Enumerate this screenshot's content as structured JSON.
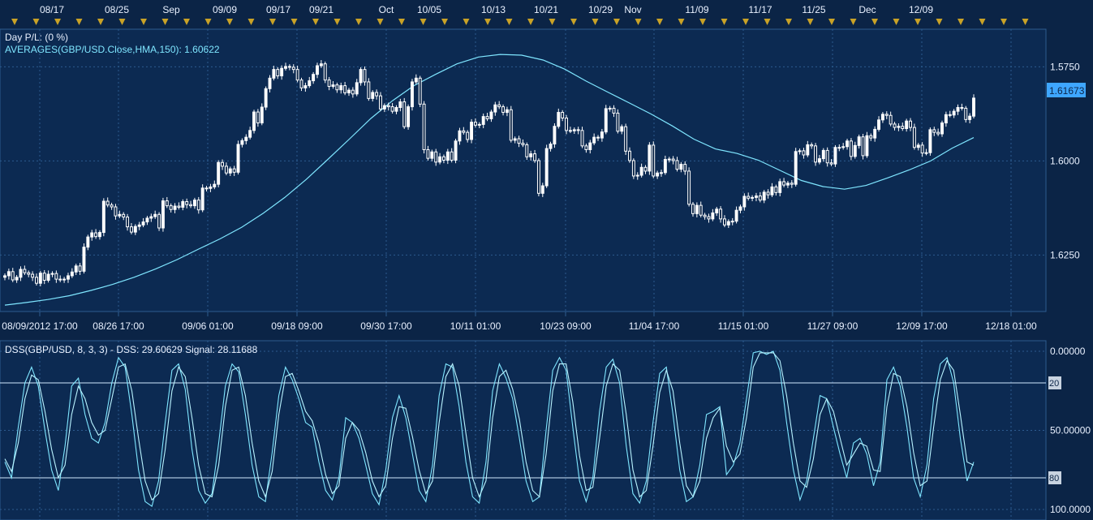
{
  "colors": {
    "background": "#0b2446",
    "panel": "#0c2a52",
    "grid": "#2d5b8f",
    "text": "#e9f1ff",
    "cyan": "#7fe6ff",
    "white": "#ffffff",
    "marker": "#c9a227",
    "price_label_bg": "#3ea6ff"
  },
  "top_axis": {
    "labels": [
      "08/17",
      "08/25",
      "Sep",
      "09/09",
      "09/17",
      "09/21",
      "Oct",
      "10/05",
      "10/13",
      "10/21",
      "10/29",
      "Nov",
      "11/09",
      "11/17",
      "11/25",
      "Dec",
      "12/09"
    ]
  },
  "price_panel": {
    "legend_line1": "Day P/L: (0 %)",
    "legend_line2": "AVERAGES(GBP/USD.Close,HMA,150): 1.60622",
    "y_ticks": [
      "1.6250",
      "1.6000",
      "1.5750"
    ],
    "last_price_label": "1.61673"
  },
  "bottom_axis": {
    "labels": [
      "08/09/2012 17:00",
      "08/26 17:00",
      "09/06 01:00",
      "09/18 09:00",
      "09/30 17:00",
      "10/11 01:00",
      "10/23 09:00",
      "11/04 17:00",
      "11/15 01:00",
      "11/27 09:00",
      "12/09 17:00",
      "12/18 01:00"
    ]
  },
  "dss_panel": {
    "legend": "DSS(GBP/USD, 8, 3, 3) -  DSS: 29.60629  Signal: 28.11688",
    "y_ticks": [
      "100.0000",
      "50.00000",
      "0.00000"
    ],
    "level_labels": [
      "80",
      "20"
    ]
  },
  "chart_data": [
    {
      "type": "candlestick",
      "symbol": "GBP/USD",
      "ylim": [
        1.56,
        1.635
      ],
      "y_ticks": [
        1.575,
        1.6,
        1.625
      ],
      "grid": true,
      "x_index_range": [
        0,
        240
      ],
      "closes": [
        1.5695,
        1.5706,
        1.5684,
        1.5691,
        1.5712,
        1.5703,
        1.5699,
        1.5691,
        1.5675,
        1.5702,
        1.5683,
        1.5699,
        1.5701,
        1.5686,
        1.5684,
        1.5686,
        1.5695,
        1.5705,
        1.5721,
        1.5707,
        1.5771,
        1.5798,
        1.5809,
        1.5799,
        1.581,
        1.5893,
        1.5883,
        1.5878,
        1.5854,
        1.5858,
        1.5851,
        1.5825,
        1.5811,
        1.5826,
        1.583,
        1.5838,
        1.5848,
        1.5852,
        1.5858,
        1.5822,
        1.5894,
        1.5881,
        1.5871,
        1.588,
        1.5877,
        1.5892,
        1.5884,
        1.5881,
        1.5896,
        1.587,
        1.5928,
        1.5927,
        1.5931,
        1.5938,
        1.5996,
        1.5986,
        1.5968,
        1.5979,
        1.597,
        1.6044,
        1.6054,
        1.6063,
        1.6081,
        1.613,
        1.6101,
        1.6143,
        1.6192,
        1.622,
        1.6243,
        1.6226,
        1.6246,
        1.6251,
        1.6249,
        1.6243,
        1.6215,
        1.6194,
        1.62,
        1.6213,
        1.623,
        1.6253,
        1.6258,
        1.6215,
        1.6198,
        1.6202,
        1.6189,
        1.62,
        1.6181,
        1.6188,
        1.6178,
        1.6208,
        1.6243,
        1.621,
        1.6166,
        1.6182,
        1.6173,
        1.6138,
        1.6147,
        1.6144,
        1.6132,
        1.6142,
        1.6157,
        1.6091,
        1.6144,
        1.621,
        1.622,
        1.6151,
        1.603,
        1.6007,
        1.6024,
        1.5997,
        1.6011,
        1.6002,
        1.6024,
        1.6002,
        1.6053,
        1.608,
        1.6076,
        1.6057,
        1.6103,
        1.6095,
        1.6097,
        1.6118,
        1.6112,
        1.613,
        1.6149,
        1.6144,
        1.6129,
        1.6136,
        1.6055,
        1.6059,
        1.6047,
        1.6043,
        1.6011,
        1.6019,
        1.6001,
        1.5914,
        1.5934,
        1.6033,
        1.6045,
        1.6092,
        1.6129,
        1.6114,
        1.6081,
        1.608,
        1.6083,
        1.6081,
        1.604,
        1.603,
        1.6048,
        1.6063,
        1.6061,
        1.6077,
        1.6139,
        1.614,
        1.6127,
        1.6079,
        1.6091,
        1.6026,
        1.6001,
        1.596,
        1.5962,
        1.5983,
        1.5973,
        1.6042,
        1.596,
        1.5968,
        1.5969,
        1.6004,
        1.6005,
        1.6001,
        1.5978,
        1.5991,
        1.5973,
        1.5885,
        1.586,
        1.5882,
        1.5856,
        1.5852,
        1.5846,
        1.5862,
        1.5872,
        1.5846,
        1.583,
        1.5839,
        1.584,
        1.5869,
        1.5878,
        1.5906,
        1.5901,
        1.5903,
        1.5907,
        1.5896,
        1.5917,
        1.591,
        1.5931,
        1.5916,
        1.5945,
        1.5936,
        1.5941,
        1.5938,
        1.6025,
        1.6027,
        1.6016,
        1.6043,
        1.604,
        1.5997,
        1.6006,
        1.6028,
        1.5995,
        1.5992,
        1.6036,
        1.6036,
        1.6038,
        1.6053,
        1.6012,
        1.6041,
        1.6064,
        1.6014,
        1.6067,
        1.6061,
        1.6084,
        1.6109,
        1.6124,
        1.6121,
        1.6098,
        1.6089,
        1.6092,
        1.6086,
        1.6106,
        1.6089,
        1.6036,
        1.6042,
        1.6021,
        1.6022,
        1.6083,
        1.6076,
        1.6072,
        1.6101,
        1.6123,
        1.6122,
        1.6132,
        1.6142,
        1.614,
        1.611,
        1.6119,
        1.6167
      ],
      "hma150": [
        1.5617,
        1.5624,
        1.5632,
        1.5642,
        1.5656,
        1.5672,
        1.5691,
        1.5713,
        1.5738,
        1.5766,
        1.5793,
        1.5824,
        1.5861,
        1.5903,
        1.5951,
        1.6004,
        1.6058,
        1.6113,
        1.616,
        1.62,
        1.623,
        1.6258,
        1.6276,
        1.6283,
        1.6281,
        1.6268,
        1.6244,
        1.6212,
        1.6183,
        1.6154,
        1.6125,
        1.6093,
        1.6058,
        1.6032,
        1.602,
        1.6002,
        1.5975,
        1.5948,
        1.5932,
        1.5925,
        1.5935,
        1.5955,
        1.5976,
        1.6,
        1.6034,
        1.6062
      ]
    },
    {
      "type": "line",
      "title": "DSS(GBP/USD, 8, 3, 3)",
      "ylim": [
        0,
        100
      ],
      "y_ticks": [
        0,
        50,
        100
      ],
      "levels": [
        20,
        80
      ],
      "series": [
        {
          "name": "DSS",
          "values": [
            30,
            20,
            52,
            80,
            90,
            78,
            50,
            25,
            12,
            40,
            78,
            83,
            60,
            45,
            42,
            55,
            80,
            96,
            90,
            60,
            25,
            5,
            2,
            18,
            55,
            88,
            92,
            76,
            38,
            12,
            4,
            10,
            42,
            78,
            92,
            87,
            60,
            28,
            8,
            5,
            36,
            72,
            90,
            82,
            70,
            55,
            52,
            30,
            12,
            6,
            20,
            58,
            55,
            45,
            28,
            10,
            3,
            25,
            58,
            72,
            58,
            35,
            12,
            5,
            28,
            72,
            92,
            90,
            65,
            30,
            8,
            4,
            30,
            75,
            92,
            83,
            70,
            45,
            18,
            5,
            8,
            50,
            88,
            96,
            88,
            52,
            18,
            5,
            20,
            62,
            90,
            95,
            80,
            40,
            10,
            4,
            18,
            55,
            86,
            90,
            60,
            25,
            5,
            8,
            28,
            60,
            62,
            65,
            22,
            28,
            42,
            70,
            99,
            100,
            98,
            100,
            88,
            55,
            25,
            6,
            18,
            45,
            72,
            70,
            52,
            35,
            20,
            42,
            45,
            35,
            15,
            30,
            82,
            90,
            78,
            52,
            20,
            8,
            28,
            70,
            92,
            96,
            80,
            45,
            18,
            30
          ]
        },
        {
          "name": "Signal",
          "values": [
            32,
            24,
            42,
            70,
            85,
            82,
            62,
            38,
            20,
            28,
            60,
            78,
            70,
            55,
            47,
            50,
            70,
            90,
            92,
            75,
            45,
            18,
            6,
            10,
            38,
            75,
            90,
            84,
            58,
            28,
            10,
            8,
            28,
            65,
            88,
            90,
            72,
            42,
            18,
            8,
            24,
            60,
            84,
            86,
            75,
            62,
            56,
            42,
            22,
            10,
            15,
            45,
            55,
            50,
            36,
            18,
            8,
            15,
            45,
            65,
            64,
            46,
            25,
            10,
            18,
            55,
            84,
            92,
            78,
            48,
            20,
            8,
            18,
            58,
            84,
            88,
            76,
            57,
            30,
            12,
            8,
            35,
            75,
            92,
            92,
            68,
            34,
            12,
            14,
            45,
            78,
            92,
            88,
            60,
            25,
            8,
            12,
            40,
            74,
            88,
            75,
            42,
            15,
            8,
            18,
            45,
            58,
            64,
            40,
            30,
            35,
            58,
            90,
            99,
            99,
            99,
            94,
            72,
            42,
            18,
            14,
            32,
            60,
            70,
            62,
            45,
            28,
            35,
            42,
            40,
            25,
            24,
            65,
            86,
            84,
            65,
            36,
            15,
            18,
            52,
            82,
            94,
            88,
            60,
            30,
            28
          ]
        }
      ]
    }
  ]
}
